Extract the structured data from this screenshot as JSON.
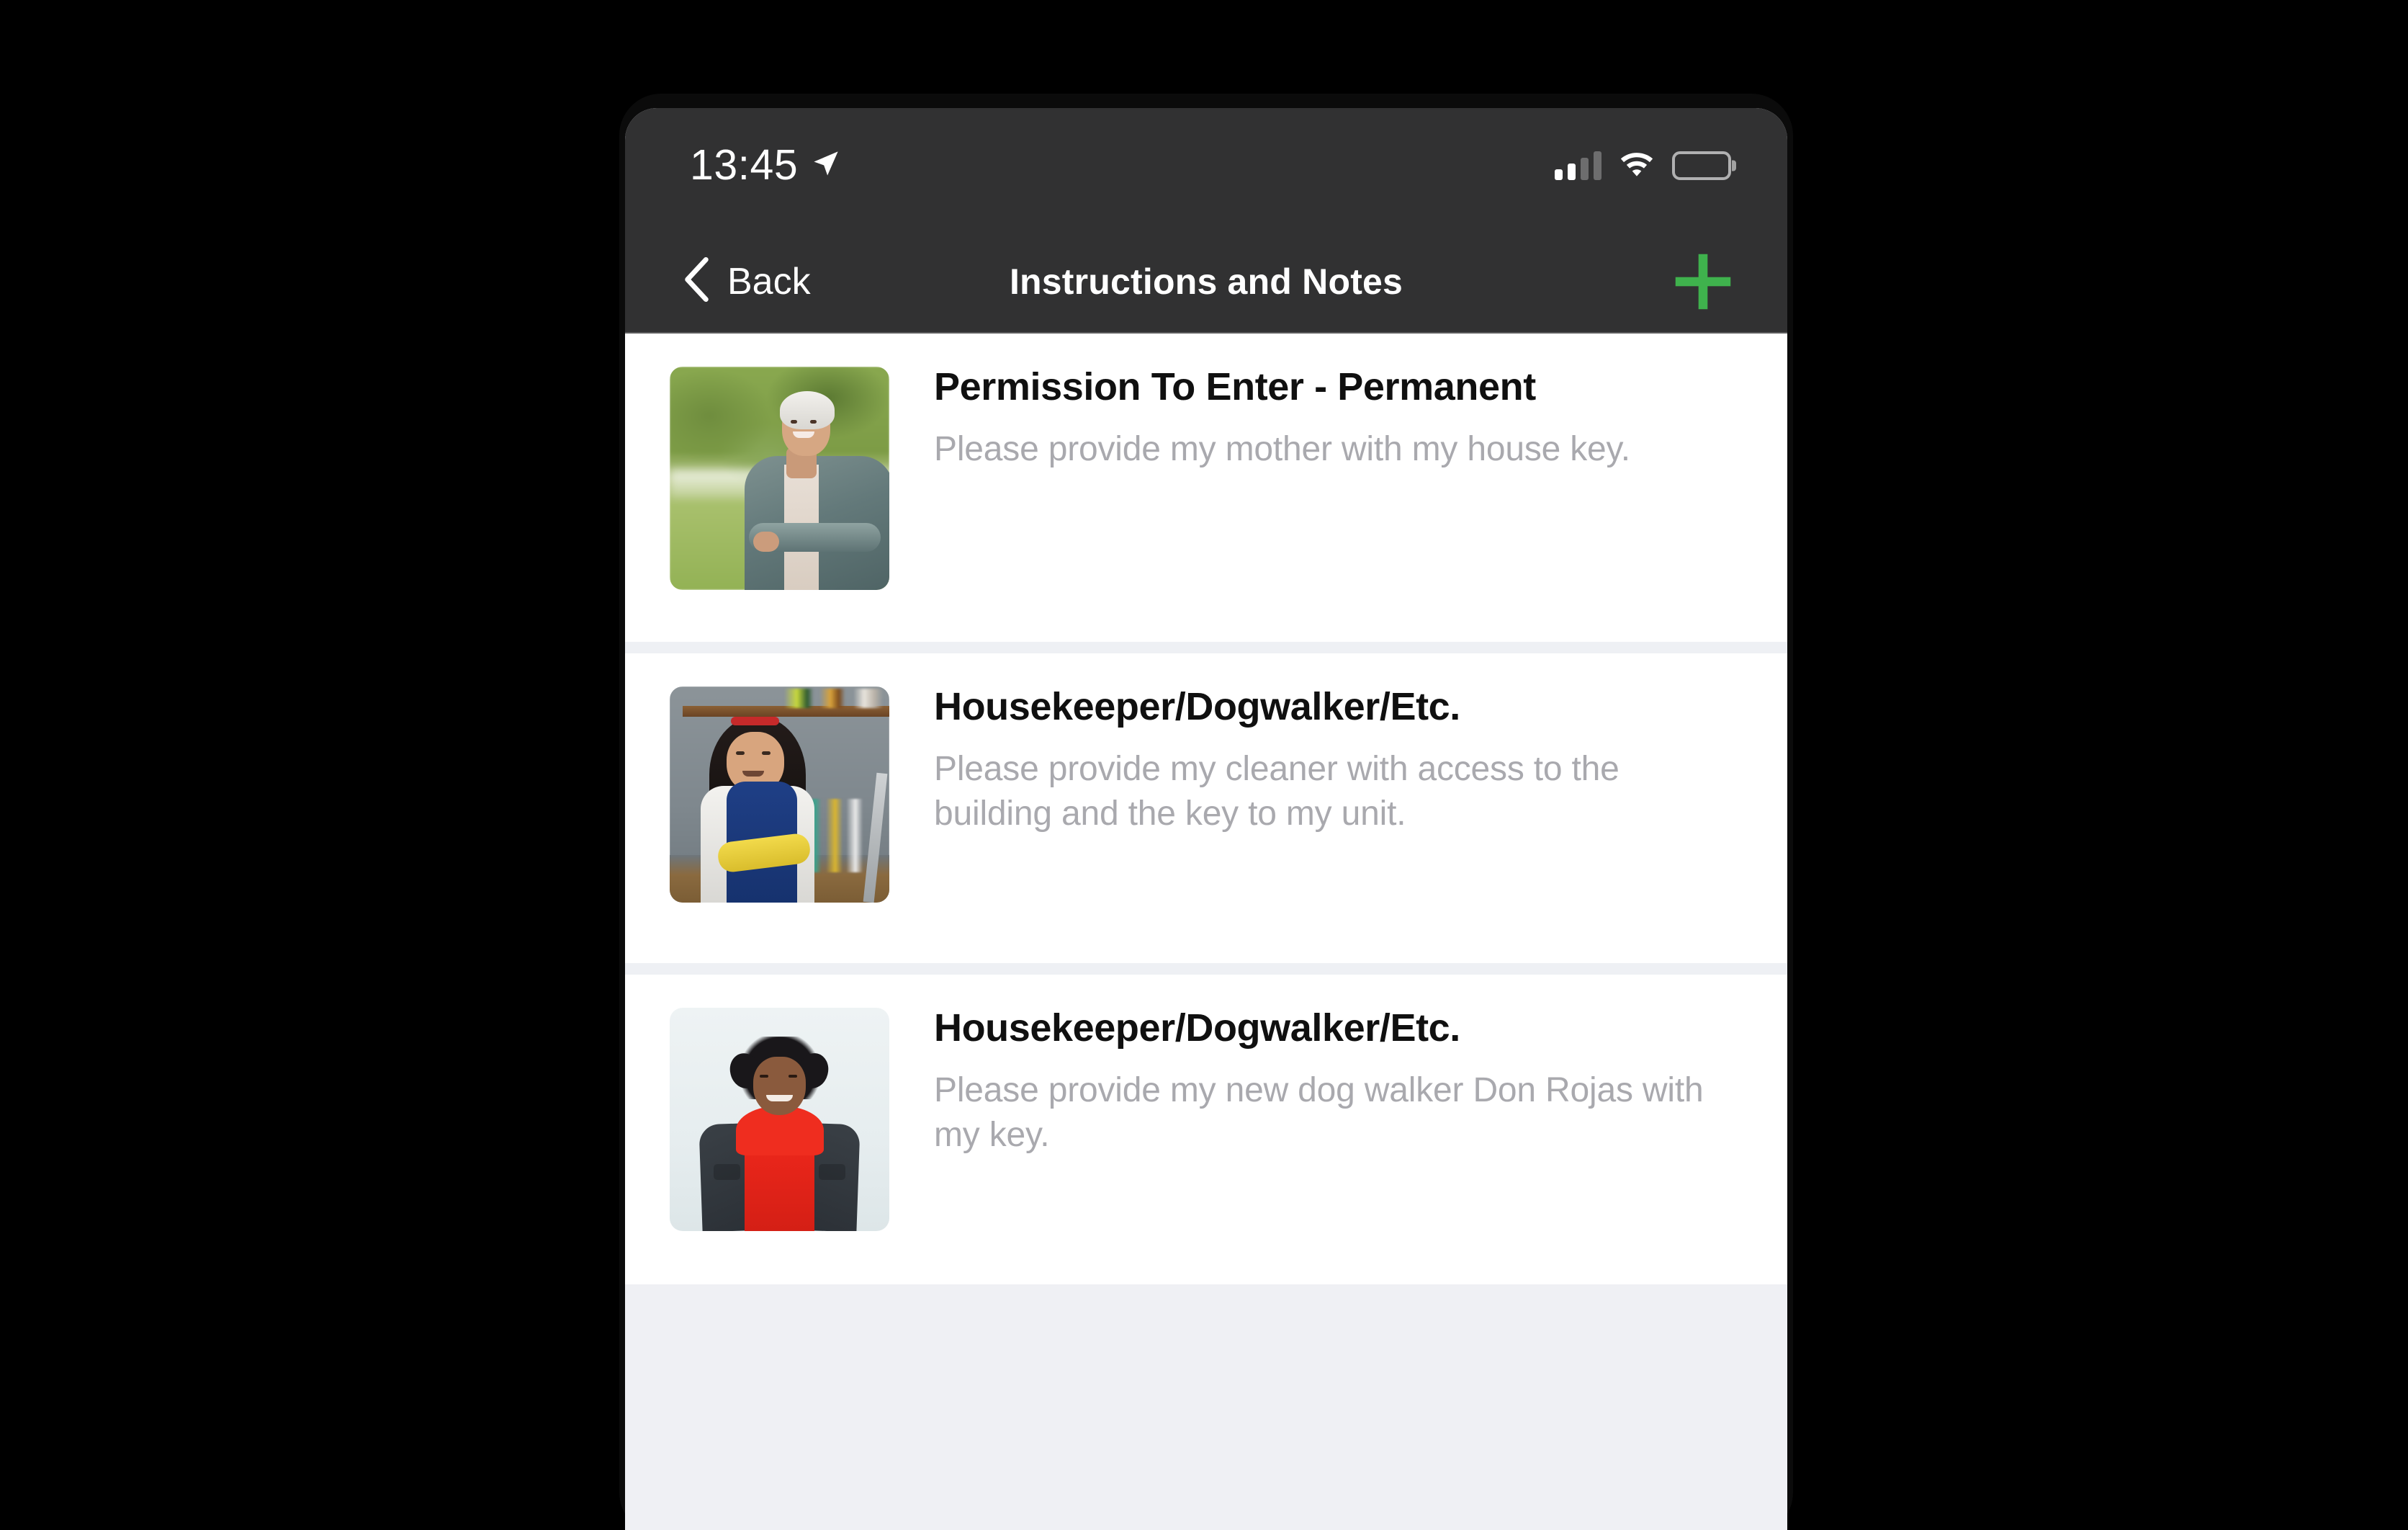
{
  "status_bar": {
    "time": "13:45",
    "location_icon": "location-arrow-icon",
    "signal_icon": "cellular-signal-icon",
    "signal_bars_filled": 2,
    "signal_bars_total": 4,
    "wifi_icon": "wifi-icon",
    "battery_icon": "battery-icon",
    "battery_percent": 75
  },
  "nav_bar": {
    "back_label": "Back",
    "back_icon": "chevron-left-icon",
    "title": "Instructions and Notes",
    "add_icon": "plus-icon"
  },
  "colors": {
    "nav_background": "#313132",
    "accent_green": "#3fb24d",
    "title_text": "#101010",
    "subtitle_text": "#a9a9ae",
    "list_background": "#eff0f4",
    "card_background": "#ffffff",
    "separator": "#eef0f4"
  },
  "list": {
    "items": [
      {
        "title": "Permission To Enter - Permanent",
        "subtitle": "Please provide my mother with my house key.",
        "thumbnail": "older-woman-in-park-photo"
      },
      {
        "title": "Housekeeper/Dogwalker/Etc.",
        "subtitle": "Please provide my cleaner with access to the building and the key to my unit.",
        "thumbnail": "cleaner-in-kitchen-photo"
      },
      {
        "title": "Housekeeper/Dogwalker/Etc.",
        "subtitle": "Please provide my new dog walker Don Rojas with my key.",
        "thumbnail": "man-in-red-hoodie-photo"
      }
    ]
  }
}
